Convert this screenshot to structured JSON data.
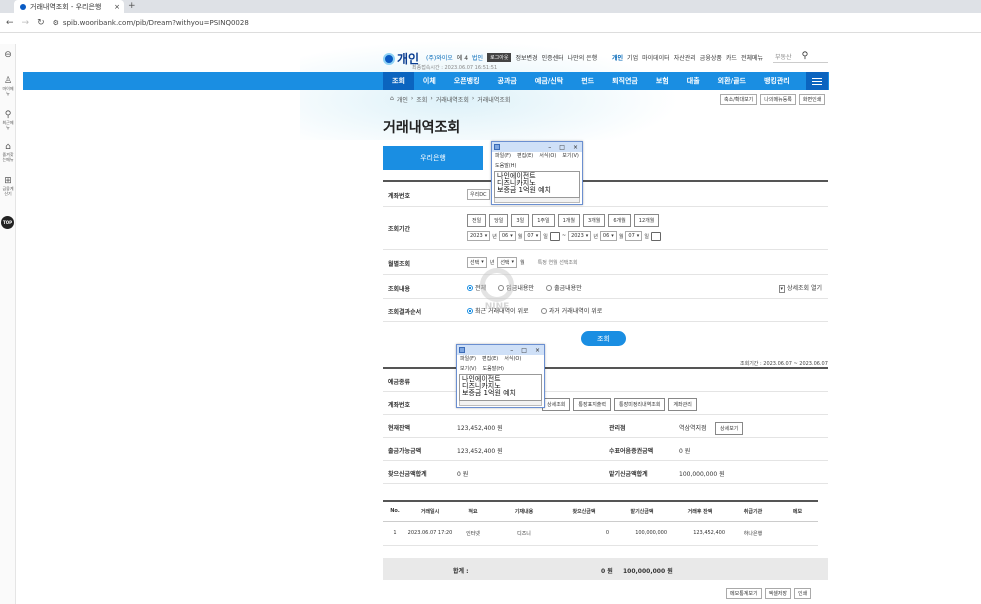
{
  "browser": {
    "tab_title": "거래내역조회 - 우리은행",
    "url": "spib.wooribank.com/pib/Dream?withyou=PSINQ0028",
    "new_tab": "+",
    "close": "×"
  },
  "left_sidebar": {
    "items": [
      {
        "label": "메뉴",
        "icon": "menu-icon"
      },
      {
        "label": "마이메뉴",
        "icon": "person-icon"
      },
      {
        "label": "최근메뉴",
        "icon": "pin-icon"
      },
      {
        "label": "즐겨찾는메뉴",
        "icon": "lock-icon"
      },
      {
        "label": "금융계산기",
        "icon": "grid-icon"
      }
    ],
    "top": "TOP"
  },
  "header": {
    "logo_text": "개인",
    "user_name": "(주)와이오",
    "user_id": "에 4",
    "mode": "법인",
    "logout": "로그아웃",
    "links": [
      "정보변경",
      "인증센터",
      "나만의 은행"
    ],
    "last_login": "최종접속시간 : 2023.06.07 16:51:51",
    "gnb": [
      "개인",
      "기업",
      "마이데이터",
      "자산관리",
      "금융상품",
      "카드",
      "전체메뉴"
    ],
    "search_placeholder": "부동산"
  },
  "nav": {
    "items": [
      "조회",
      "이체",
      "오픈뱅킹",
      "공과금",
      "예금/신탁",
      "펀드",
      "퇴직연금",
      "보험",
      "대출",
      "외환/골드",
      "뱅킹관리",
      "ISA"
    ],
    "active": 0
  },
  "breadcrumb": [
    "개인",
    "조회",
    "거래내역조회",
    "거래내역조회"
  ],
  "crumb_buttons": [
    "축소/확대보기",
    "나의메뉴등록",
    "화면인쇄"
  ],
  "page": {
    "title": "거래내역조회",
    "bank_tab": "우리은행"
  },
  "form": {
    "account_label": "계좌번호",
    "account_value": "우리DC",
    "period_label": "조회기간",
    "period_buttons": [
      "전일",
      "당일",
      "3일",
      "1주일",
      "1개월",
      "3개월",
      "6개월",
      "12개월"
    ],
    "from": {
      "year": "2023",
      "month": "06",
      "day": "07"
    },
    "to": {
      "year": "2023",
      "month": "06",
      "day": "07"
    },
    "year_unit": "년",
    "month_unit": "월",
    "day_unit": "일",
    "tilde": "~",
    "monthly_label": "월별조회",
    "monthly_year": "선택",
    "monthly_month": "선택",
    "monthly_note": "특정 연월 선택조회",
    "content_label": "조회내용",
    "content_options": [
      "전체",
      "입금내용만",
      "출금내용만"
    ],
    "detail_toggle": "상세조회 열기",
    "order_label": "조회결과순서",
    "order_options": [
      "최근 거래내역이 위로",
      "과거 거래내역이 위로"
    ],
    "query_button": "조회"
  },
  "result": {
    "period_text": "조회기간 : 2023.06.07 ~ 2023.06.07",
    "deposit_type_label": "예금종류",
    "account_label": "계좌번호",
    "account_buttons": [
      "상세조회",
      "통장표지출력",
      "통장미정리내역조회",
      "계좌관리"
    ],
    "balance_label": "현재잔액",
    "balance_value": "123,452,400 원",
    "branch_label": "관리점",
    "branch_value": "역삼역지점",
    "branch_button": "상세보기",
    "withdrawable_label": "출금가능금액",
    "withdrawable_value": "123,452,400 원",
    "check_label": "수표어음증권금액",
    "check_value": "0 원",
    "out_total_label": "찾으신금액합계",
    "out_total_value": "0 원",
    "in_total_label": "맡기신금액합계",
    "in_total_value": "100,000,000 원"
  },
  "table": {
    "headers": [
      "No.",
      "거래일시",
      "적요",
      "기재내용",
      "찾으신금액",
      "맡기신금액",
      "거래후 잔액",
      "취급기관",
      "메모"
    ],
    "rows": [
      [
        "1",
        "2023.06.07 17:20",
        "인터넷",
        "디즈니",
        "0",
        "100,000,000",
        "123,452,400",
        "하나은행",
        ""
      ]
    ],
    "sum_label": "합계 :",
    "sum_out": "0 원",
    "sum_in": "100,000,000 원"
  },
  "bottom_buttons": [
    "메모통계보기",
    "엑셀저장",
    "인쇄"
  ],
  "notepad": {
    "menu": [
      "파일(F)",
      "편집(E)",
      "서식(O)",
      "보기(V)",
      "도움말(H)"
    ],
    "lines": [
      "나인에이전트",
      "디즈니카지노",
      "보증금 1억원 예치"
    ],
    "controls": [
      "–",
      "□",
      "×"
    ]
  },
  "watermark": "NINE"
}
